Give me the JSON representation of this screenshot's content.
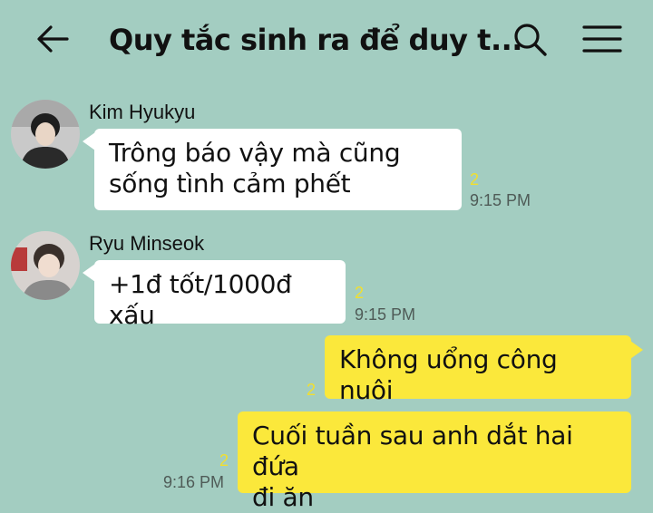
{
  "header": {
    "title": "Quy tắc sinh ra để duy t...",
    "back_icon": "arrow-left-icon",
    "search_icon": "search-icon",
    "menu_icon": "hamburger-menu-icon"
  },
  "messages": [
    {
      "sender": "Kim Hyukyu",
      "text_lines": [
        "Trông báo vậy mà cũng",
        "sống tình cảm phết"
      ],
      "unread": "2",
      "time": "9:15 PM",
      "direction": "incoming"
    },
    {
      "sender": "Ryu Minseok",
      "text_lines": [
        "+1đ tốt/1000đ xấu"
      ],
      "unread": "2",
      "time": "9:15 PM",
      "direction": "incoming"
    },
    {
      "text_lines": [
        "Không uổng công nuôi"
      ],
      "unread": "2",
      "direction": "outgoing"
    },
    {
      "text_lines": [
        "Cuối tuần sau anh dắt hai đứa",
        "đi ăn"
      ],
      "unread": "2",
      "time": "9:16 PM",
      "direction": "outgoing"
    }
  ],
  "colors": {
    "background": "#a3cdc1",
    "incoming_bubble": "#ffffff",
    "outgoing_bubble": "#fbe83b",
    "unread_count": "#f2df2e"
  }
}
